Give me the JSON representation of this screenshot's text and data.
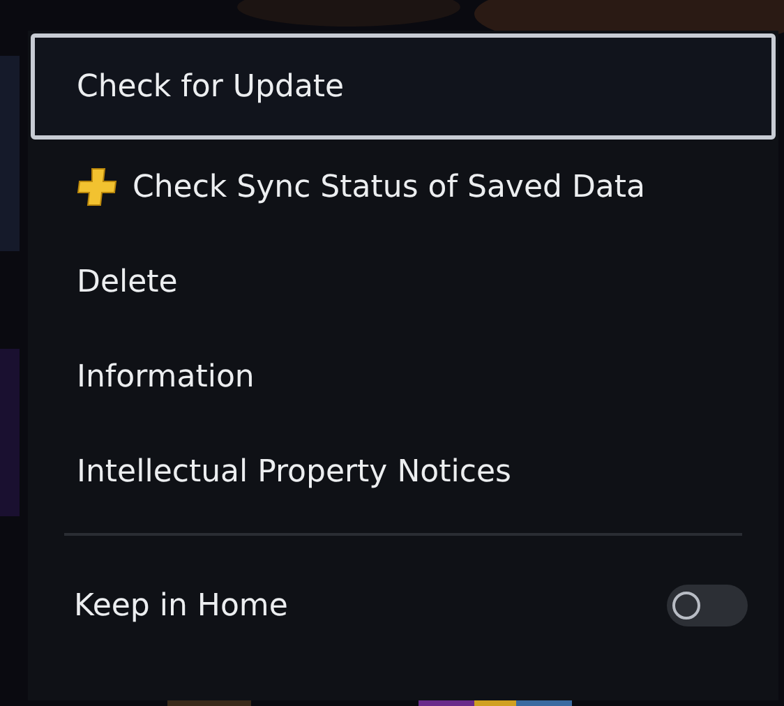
{
  "menu": {
    "items": [
      {
        "label": "Check for Update",
        "selected": true,
        "kind": "plain"
      },
      {
        "label": "Check Sync Status of Saved Data",
        "selected": false,
        "kind": "plus"
      },
      {
        "label": "Delete",
        "selected": false,
        "kind": "plain"
      },
      {
        "label": "Information",
        "selected": false,
        "kind": "plain"
      },
      {
        "label": "Intellectual Property Notices",
        "selected": false,
        "kind": "plain"
      }
    ],
    "toggle": {
      "label": "Keep in Home",
      "on": false
    }
  }
}
